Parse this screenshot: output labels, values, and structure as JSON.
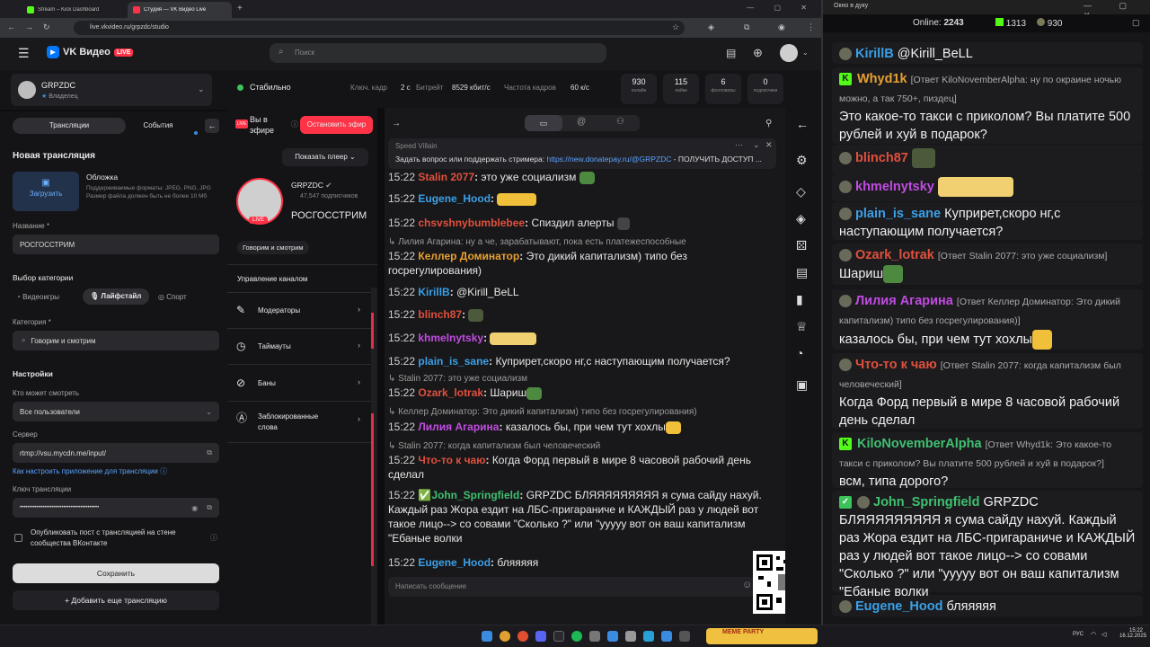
{
  "browser": {
    "tabs": [
      "Stream – Kick Dashboard",
      "Студия — VK Видео Live"
    ],
    "url": "live.vkvideo.ru/grpzdc/studio"
  },
  "vk": {
    "brand": "VK Видео",
    "live_badge": "LIVE",
    "search_placeholder": "Поиск",
    "channel": {
      "name": "GRPZDC",
      "role": "Владелец"
    },
    "status": "Стабильно",
    "keyframe_label": "Ключ. кадр",
    "keyframe_value": "2 с",
    "bitrate_label": "Битрейт",
    "bitrate_value": "8529 кбит/с",
    "fps_label": "Частота кадров",
    "fps_value": "60 к/с",
    "stats": [
      {
        "n": "930",
        "t": "онлайн"
      },
      {
        "n": "115",
        "t": "лайки"
      },
      {
        "n": "6",
        "t": "фолловеры"
      },
      {
        "n": "0",
        "t": "подписчики"
      }
    ]
  },
  "left": {
    "tab_streams": "Трансляции",
    "tab_events": "События",
    "new_stream": "Новая трансляция",
    "cover_title": "Обложка",
    "upload": "Загрузить",
    "cover_hint": "Поддерживаемые форматы: JPEG, PNG, JPG Размер файла должен быть не более 10 Мб",
    "name_label": "Название *",
    "name_value": "РОСГОССТРИМ",
    "category_choice": "Выбор категории",
    "cat_games": "Видеоигры",
    "cat_life": "Лайфстайл",
    "cat_sport": "Спорт",
    "category_label": "Категория *",
    "category_value": "Говорим и смотрим",
    "settings": "Настройки",
    "who_label": "Кто может смотреть",
    "who_value": "Все пользователи",
    "server_label": "Сервер",
    "server_value": "rtmp://vsu.mycdn.me/input/",
    "howto": "Как настроить приложение для трансляции",
    "key_label": "Ключ трансляции",
    "key_value": "••••••••••••••••••••••••••••••••••••••••••",
    "publish": "Опубликовать пост с трансляцией на стене сообщества ВКонтакте",
    "save": "Сохранить",
    "add": "Добавить еще трансляцию"
  },
  "mid": {
    "on_air": "Вы в эфире",
    "stop": "Остановить эфир",
    "show_player": "Показать плеер",
    "channel_name": "GRPZDC",
    "subs": "47,547 подписчиков",
    "title": "РОСГОССТРИМ",
    "tag": "Говорим и смотрим",
    "manage": "Управление каналом",
    "items": [
      "Модераторы",
      "Таймауты",
      "Баны",
      "Заблокированные слова"
    ]
  },
  "chat": {
    "pinned_author": "Speed Villain",
    "pinned_text": "Задать вопрос или поддержать стримера:",
    "pinned_link": "https://new.donatepay.ru/@GRPZDC",
    "pinned_tail": " - ПОЛУЧИТЬ ДОСТУП ...",
    "input_placeholder": "Написать сообщение",
    "messages": [
      {
        "time": "15:22",
        "user": "Stalin 2077",
        "color": "#e0503c",
        "text": "это уже социализм"
      },
      {
        "time": "15:22",
        "user": "Eugene_Hood",
        "color": "#3aa0e8",
        "text": ""
      },
      {
        "time": "15:22",
        "user": "chsvshnybumblebee",
        "color": "#e0503c",
        "text": "Спиздил алерты"
      },
      {
        "reply": "Лилия Агарина: ну а че, зарабатывают, пока есть платежеспособные"
      },
      {
        "time": "15:22",
        "user": "Келлер Доминатор",
        "color": "#e8a030",
        "text": "Это дикий капитализм) типо без госрегулирования)"
      },
      {
        "time": "15:22",
        "user": "KirillB",
        "color": "#3aa0e8",
        "text": "@Kirill_BeLL"
      },
      {
        "time": "15:22",
        "user": "blinch87",
        "color": "#e0503c",
        "text": ""
      },
      {
        "time": "15:22",
        "user": "khmelnytsky",
        "color": "#c04ce0",
        "text": ""
      },
      {
        "time": "15:22",
        "user": "plain_is_sane",
        "color": "#3aa0e8",
        "text": "Куприрет,скоро нг,с наступающим получается?"
      },
      {
        "reply": "Stalin 2077: это уже социализм"
      },
      {
        "time": "15:22",
        "user": "Ozark_lotrak",
        "color": "#e0503c",
        "text": "Шариш"
      },
      {
        "reply": "Келлер Доминатор: Это дикий капитализм) типо без госрегулирования)"
      },
      {
        "time": "15:22",
        "user": "Лилия Агарина",
        "color": "#c04ce0",
        "text": "казалось бы, при чем тут хохлы"
      },
      {
        "reply": "Stalin 2077: когда капитализм был человеческий"
      },
      {
        "time": "15:22",
        "user": "Что-то к чаю",
        "color": "#e0503c",
        "text": "Когда Форд первый в мире 8 часовой рабочий день сделал"
      },
      {
        "time": "15:22",
        "user": "John_Springfield",
        "color": "#40c070",
        "text": "GRPZDC БЛЯЯЯЯЯЯЯЯЯ я сума сайду нахуй. Каждый раз Жора ездит на ЛБС-пригараниче и КАЖДЫЙ раз у людей вот такое лицо--> со совами \"Сколько ?\" или \"ууууу вот он ваш капитализм \"Ебаные волки"
      },
      {
        "time": "15:22",
        "user": "Eugene_Hood",
        "color": "#3aa0e8",
        "text": "бляяяяя"
      }
    ]
  },
  "chatwin": {
    "title": "Окно в дуку",
    "online_label": "Online:",
    "online": "2243",
    "kick_count": "1313",
    "vk_count": "930",
    "messages": [
      {
        "user": "KirillB",
        "color": "#3aa0e8",
        "text": "@Kirill_BeLL"
      },
      {
        "user": "Whyd1k",
        "color": "#e8a030",
        "ref": "[Ответ KiloNovemberAlpha: ну по окраине ночью можно, а так 750+, пиздец]",
        "text": "Это какое-то такси с приколом? Вы платите 500 рублей и хуй в подарок?"
      },
      {
        "user": "blinch87",
        "color": "#e0503c",
        "text": ""
      },
      {
        "user": "khmelnytsky",
        "color": "#c04ce0",
        "text": ""
      },
      {
        "user": "plain_is_sane",
        "color": "#3aa0e8",
        "text": "Куприрет,скоро нг,с наступающим получается?"
      },
      {
        "user": "Ozark_lotrak",
        "color": "#e0503c",
        "ref": "[Ответ Stalin 2077: это уже социализм]",
        "text": "Шариш"
      },
      {
        "user": "Лилия Агарина",
        "color": "#c04ce0",
        "ref": "[Ответ Келлер Доминатор: Это дикий капитализм) типо без госрегулирования)]",
        "text": "казалось бы, при чем тут хохлы"
      },
      {
        "user": "Что-то к чаю",
        "color": "#e0503c",
        "ref": "[Ответ Stalin 2077: когда капитализм был человеческий]",
        "text": "Когда Форд первый в мире 8 часовой рабочий день сделал"
      },
      {
        "user": "KiloNovemberAlpha",
        "color": "#40c070",
        "ref": "[Ответ Whyd1k: Это какое-то такси с приколом? Вы платите 500 рублей и хуй в подарок?]",
        "text": "всм, типа дорого?"
      },
      {
        "user": "John_Springfield",
        "color": "#40c070",
        "text": "GRPZDC БЛЯЯЯЯЯЯЯЯЯ я сума сайду нахуй. Каждый раз Жора ездит на ЛБС-пригараниче и КАЖДЫЙ раз у людей вот такое лицо--> со совами \"Сколько ?\" или \"ууууу вот он ваш капитализм \"Ебаные волки"
      },
      {
        "user": "Eugene_Hood",
        "color": "#3aa0e8",
        "text": "бляяяяя"
      }
    ]
  },
  "taskbar": {
    "lang": "РУС",
    "time": "15:22",
    "date": "16.12.2025",
    "widget": "MEME PARTY"
  }
}
